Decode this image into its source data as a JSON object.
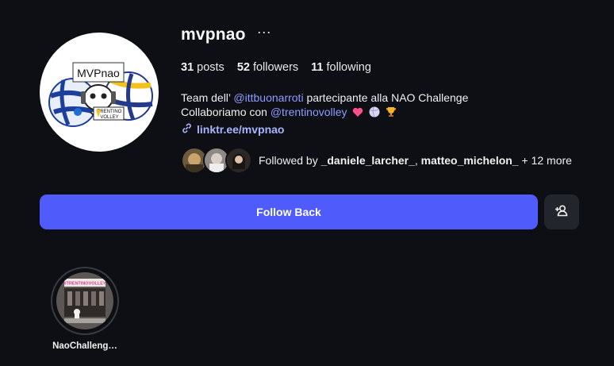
{
  "profile": {
    "avatar_text": "MVPnao",
    "avatar_badge_line1": "TRENTINO",
    "avatar_badge_line2": "VOLLEY",
    "username": "mvpnao",
    "more_glyph": "···"
  },
  "stats": {
    "posts_count": "31",
    "posts_label": "posts",
    "followers_count": "52",
    "followers_label": "followers",
    "following_count": "11",
    "following_label": "following"
  },
  "bio": {
    "line1_prefix": "Team dell’ ",
    "line1_mention": "@ittbuonarroti",
    "line1_suffix": " partecipante alla NAO Challenge",
    "line2_prefix": "Collaboriamo con ",
    "line2_mention": "@trentinovolley",
    "emojis": [
      "heart-icon",
      "volleyball-icon",
      "trophy-icon"
    ],
    "link_text": "linktr.ee/mvpnao",
    "link_icon": "link-icon"
  },
  "followed_by": {
    "prefix": "Followed by ",
    "user1": "_daniele_larcher_",
    "separator": ", ",
    "user2": "matteo_michelon_",
    "suffix": " + 12 more"
  },
  "actions": {
    "follow_back_label": "Follow Back",
    "suggest_icon": "add-person-icon"
  },
  "highlights": [
    {
      "label": "NaoChalleng…",
      "banner_text": "#TRENTINOVOLLEY"
    }
  ],
  "colors": {
    "background": "#0e0f14",
    "accent": "#4f5bfa",
    "mention": "#8f9bff",
    "secondary_button": "#23252c"
  }
}
